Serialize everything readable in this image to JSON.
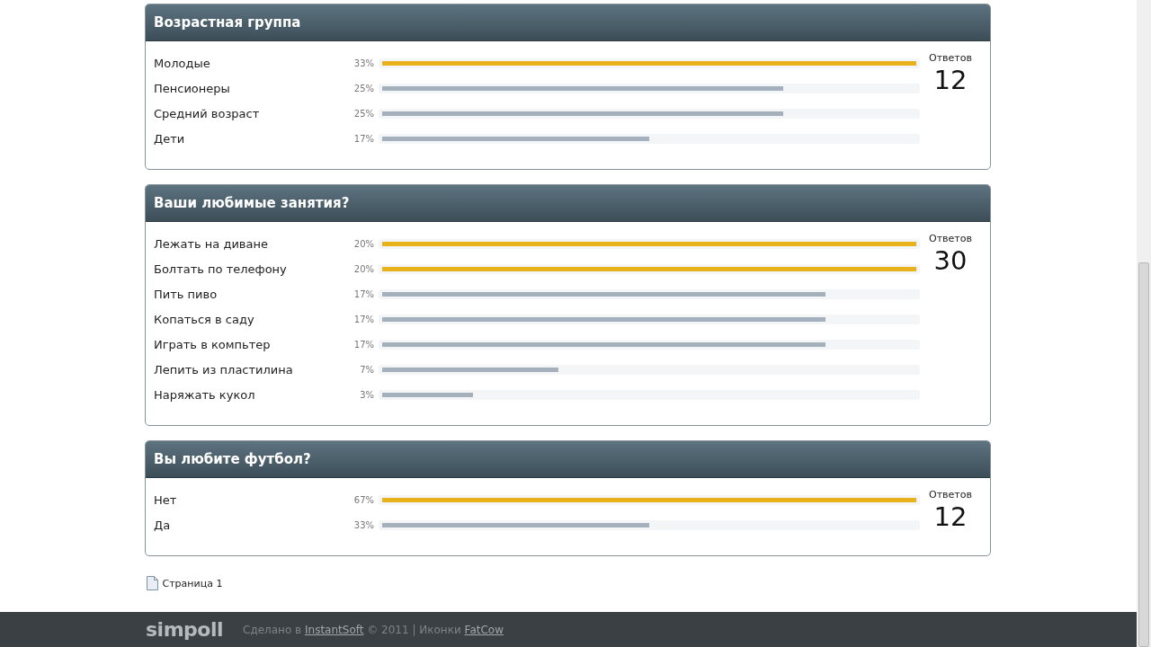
{
  "polls": [
    {
      "title": "Возрастная группа",
      "answers_label": "Ответов",
      "answers_count": "12",
      "options": [
        {
          "label": "Молодые",
          "percent": "33%",
          "level": 1,
          "leading": true
        },
        {
          "label": "Пенсионеры",
          "percent": "25%",
          "level": 0.75,
          "leading": false
        },
        {
          "label": "Средний возраст",
          "percent": "25%",
          "level": 0.75,
          "leading": false
        },
        {
          "label": "Дети",
          "percent": "17%",
          "level": 0.5,
          "leading": false
        }
      ]
    },
    {
      "title": "Ваши любимые занятия?",
      "answers_label": "Ответов",
      "answers_count": "30",
      "options": [
        {
          "label": "Лежать на диване",
          "percent": "20%",
          "level": 1,
          "leading": true
        },
        {
          "label": "Болтать по телефону",
          "percent": "20%",
          "level": 1,
          "leading": true
        },
        {
          "label": "Пить пиво",
          "percent": "17%",
          "level": 0.83,
          "leading": false
        },
        {
          "label": "Копаться в саду",
          "percent": "17%",
          "level": 0.83,
          "leading": false
        },
        {
          "label": "Играть в компьтер",
          "percent": "17%",
          "level": 0.83,
          "leading": false
        },
        {
          "label": "Лепить из пластилина",
          "percent": "7%",
          "level": 0.33,
          "leading": false
        },
        {
          "label": "Наряжать кукол",
          "percent": "3%",
          "level": 0.17,
          "leading": false
        }
      ]
    },
    {
      "title": "Вы любите футбол?",
      "answers_label": "Ответов",
      "answers_count": "12",
      "options": [
        {
          "label": "Нет",
          "percent": "67%",
          "level": 1,
          "leading": true
        },
        {
          "label": "Да",
          "percent": "33%",
          "level": 0.5,
          "leading": false
        }
      ]
    }
  ],
  "pagination": {
    "label": "Страница 1"
  },
  "footer": {
    "logo": "simpoll",
    "credit_prefix": "Сделано в",
    "credit_link": "InstantSoft",
    "credit_middle": "© 2011 | Иконки",
    "icons_link": "FatCow"
  }
}
